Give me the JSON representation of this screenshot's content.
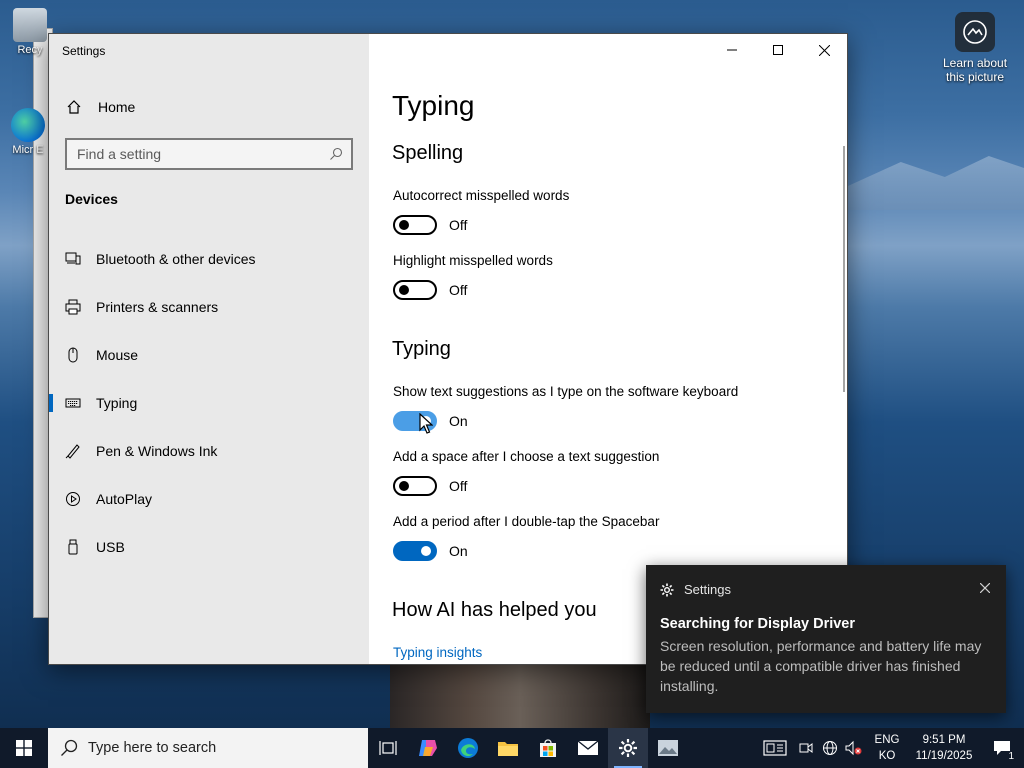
{
  "desktop": {
    "icons": [
      {
        "label": "Recy"
      },
      {
        "label": "Micr E"
      }
    ],
    "learn_about": "Learn about this picture"
  },
  "window": {
    "title": "Settings",
    "sidebar": {
      "home": "Home",
      "search_placeholder": "Find a setting",
      "section": "Devices",
      "items": [
        {
          "label": "Bluetooth & other devices",
          "icon": "bluetooth-devices-icon"
        },
        {
          "label": "Printers & scanners",
          "icon": "printer-icon"
        },
        {
          "label": "Mouse",
          "icon": "mouse-icon"
        },
        {
          "label": "Typing",
          "icon": "keyboard-icon",
          "active": true
        },
        {
          "label": "Pen & Windows Ink",
          "icon": "pen-icon"
        },
        {
          "label": "AutoPlay",
          "icon": "autoplay-icon"
        },
        {
          "label": "USB",
          "icon": "usb-icon"
        }
      ]
    },
    "main": {
      "title": "Typing",
      "spelling_heading": "Spelling",
      "spelling": [
        {
          "label": "Autocorrect misspelled words",
          "state": "Off"
        },
        {
          "label": "Highlight misspelled words",
          "state": "Off"
        }
      ],
      "typing_heading": "Typing",
      "typing": [
        {
          "label": "Show text suggestions as I type on the software keyboard",
          "state": "On"
        },
        {
          "label": "Add a space after I choose a text suggestion",
          "state": "Off"
        },
        {
          "label": "Add a period after I double-tap the Spacebar",
          "state": "On"
        }
      ],
      "ai_heading": "How AI has helped you",
      "insights_link": "Typing insights"
    }
  },
  "toast": {
    "app": "Settings",
    "title": "Searching for Display Driver",
    "body": "Screen resolution, performance and battery life may be reduced until a compatible driver has finished installing."
  },
  "taskbar": {
    "search_placeholder": "Type here to search",
    "lang_top": "ENG",
    "lang_bottom": "KO",
    "time": "9:51 PM",
    "date": "11/19/2025",
    "notification_count": "1"
  },
  "colors": {
    "accent": "#0067c0",
    "sidebar_bg": "#e9e9e9",
    "toast_bg": "#1f1f1f",
    "taskbar_bg": "#101a2a"
  }
}
